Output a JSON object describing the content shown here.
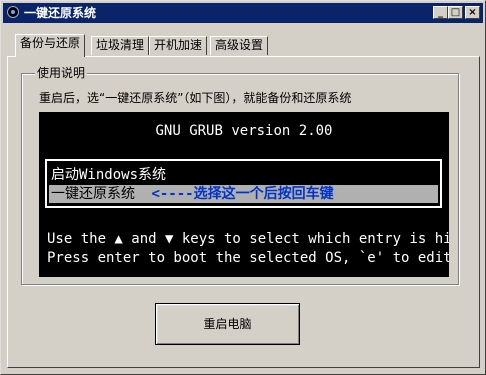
{
  "window": {
    "title": "一键还原系统",
    "minimize": "_",
    "maximize": "□",
    "close": "×"
  },
  "tabs": [
    {
      "label": "备份与还原"
    },
    {
      "label": "垃圾清理"
    },
    {
      "label": "开机加速"
    },
    {
      "label": "高级设置"
    }
  ],
  "usage": {
    "group_title": "使用说明",
    "description": "重启后，选“一键还原系统”（如下图），就能备份和还原系统"
  },
  "grub": {
    "header": "GNU GRUB  version 2.00",
    "entries": [
      {
        "label": "启动Windows系统"
      },
      {
        "label": "一键还原系统",
        "annotation": "<----选择这一个后按回车键"
      }
    ],
    "help_line1": "Use the ▲ and ▼ keys to select which entry is high",
    "help_line2": "Press enter to boot the selected OS, `e' to edit t"
  },
  "actions": {
    "restart_label": "重启电脑"
  }
}
